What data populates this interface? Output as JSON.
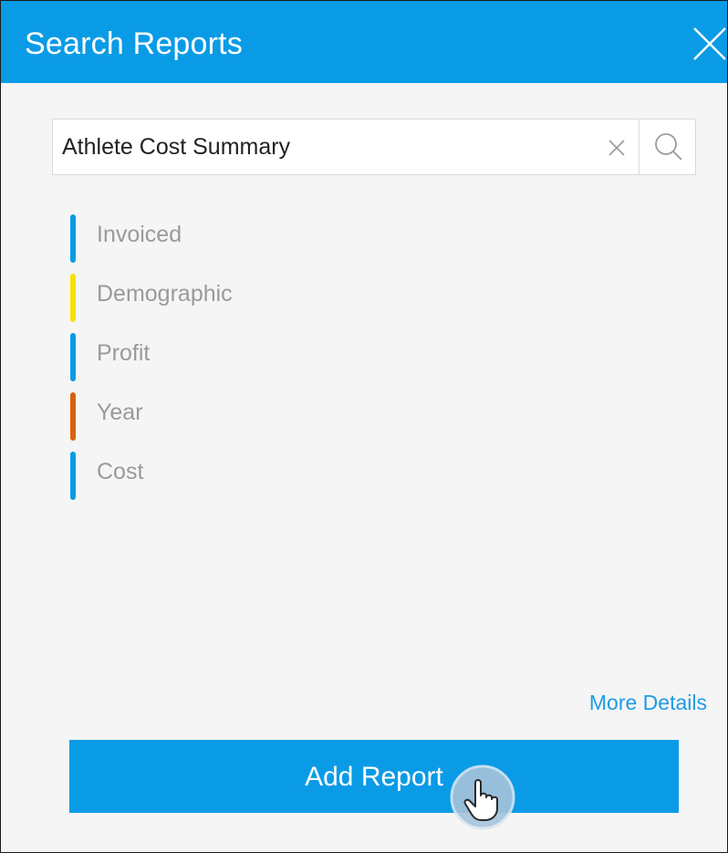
{
  "header": {
    "title": "Search Reports",
    "close_icon": "close-icon"
  },
  "search": {
    "value": "Athlete Cost Summary",
    "clear_icon": "clear-icon",
    "search_icon": "search-icon"
  },
  "tags": [
    {
      "label": "Invoiced",
      "color": "#0a9be6"
    },
    {
      "label": "Demographic",
      "color": "#f5e10a"
    },
    {
      "label": "Profit",
      "color": "#0a9be6"
    },
    {
      "label": "Year",
      "color": "#d8620a"
    },
    {
      "label": "Cost",
      "color": "#0a9be6"
    }
  ],
  "footer": {
    "more_details_label": "More Details",
    "add_report_label": "Add Report"
  },
  "colors": {
    "accent": "#0a9be6",
    "panel_background": "#f5f5f5"
  },
  "pointer_icon": "hand-pointer-icon"
}
